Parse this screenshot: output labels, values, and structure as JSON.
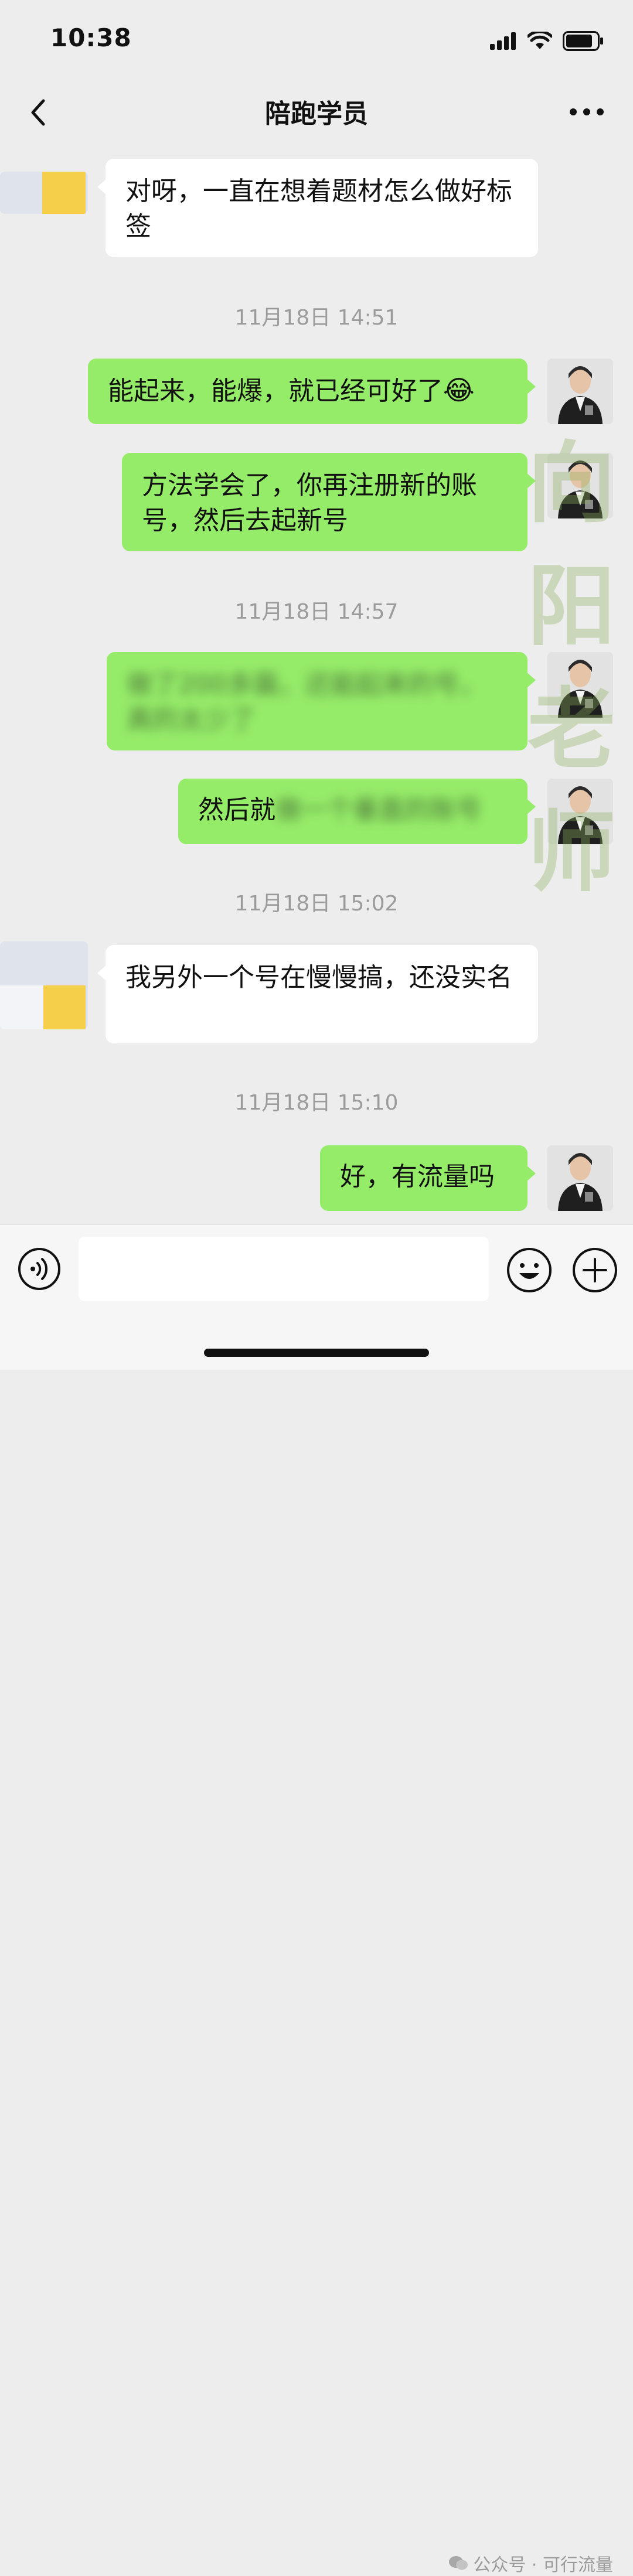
{
  "status": {
    "time": "10:38"
  },
  "header": {
    "title": "陪跑学员"
  },
  "messages": [
    {
      "type": "incoming",
      "text": "对呀，一直在想着题材怎么做好标签"
    },
    {
      "type": "timestamp",
      "text": "11月18日 14:51"
    },
    {
      "type": "outgoing",
      "text": "能起来，能爆，就已经可好了",
      "emoji": "😂"
    },
    {
      "type": "outgoing",
      "text": "方法学会了，你再注册新的账号，然后去起新号"
    },
    {
      "type": "timestamp",
      "text": "11月18日 14:57"
    },
    {
      "type": "outgoing",
      "text": "做了200多篇，还能起来的号，真的太少了",
      "blurred": true
    },
    {
      "type": "outgoing",
      "text_visible": "然后就",
      "text_blurred": "做一个垂直的账号"
    },
    {
      "type": "timestamp",
      "text": "11月18日 15:02"
    },
    {
      "type": "incoming",
      "text": "我另外一个号在慢慢搞，还没实名"
    },
    {
      "type": "timestamp",
      "text": "11月18日 15:10"
    },
    {
      "type": "outgoing",
      "text": "好，有流量吗"
    }
  ],
  "watermark": {
    "text": "向阳老师",
    "color": "#8fb15d"
  },
  "composer": {
    "value": ""
  },
  "footer": {
    "credit": "公众号 · 可行流量"
  },
  "colors": {
    "outgoing_bubble": "#95ec69",
    "incoming_bubble": "#ffffff",
    "background": "#ededed"
  }
}
